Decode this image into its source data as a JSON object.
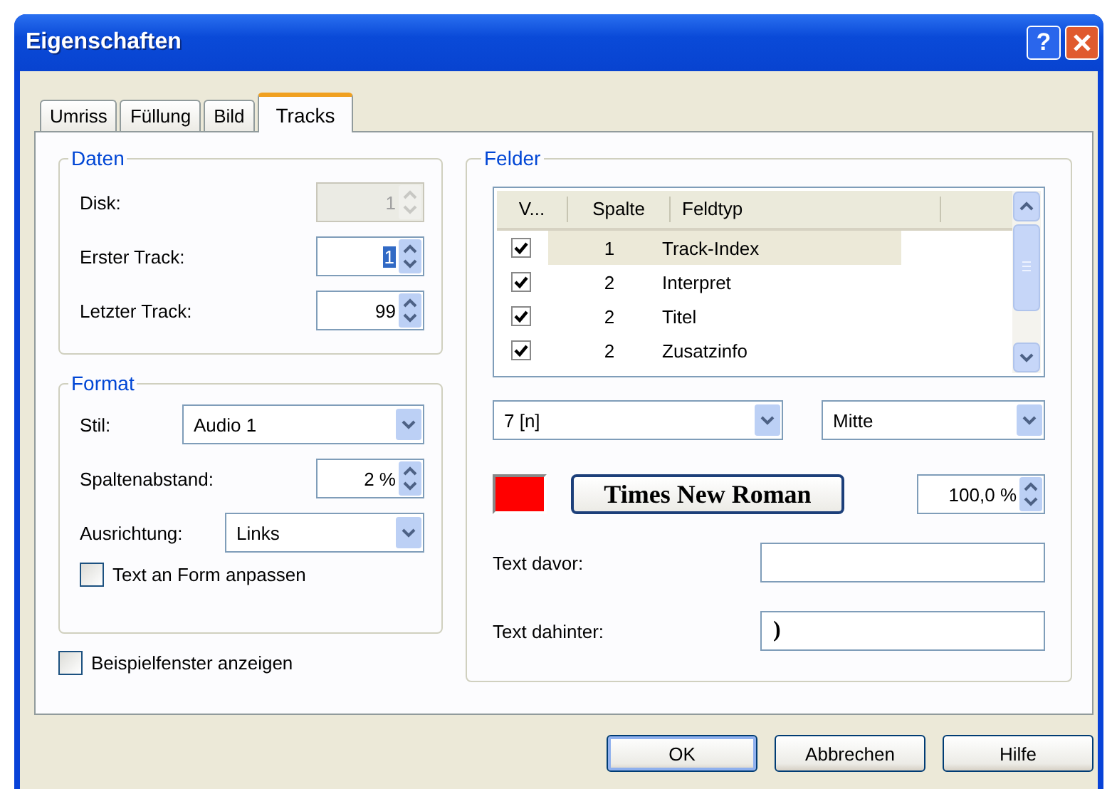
{
  "window": {
    "title": "Eigenschaften",
    "help": "?"
  },
  "tabs": [
    {
      "label": "Umriss",
      "selected": false
    },
    {
      "label": "Füllung",
      "selected": false
    },
    {
      "label": "Bild",
      "selected": false
    },
    {
      "label": "Tracks",
      "selected": true
    }
  ],
  "daten": {
    "title": "Daten",
    "rows": [
      {
        "label": "Disk:",
        "value": "1",
        "disabled": true,
        "selected": false
      },
      {
        "label": "Erster Track:",
        "value": "1",
        "disabled": false,
        "selected": true
      },
      {
        "label": "Letzter Track:",
        "value": "99",
        "disabled": false,
        "selected": false
      }
    ]
  },
  "format": {
    "title": "Format",
    "rows": [
      {
        "kind": "combo",
        "label": "Stil:",
        "value": "Audio 1"
      },
      {
        "kind": "spin",
        "label": "Spaltenabstand:",
        "value": "2 %"
      },
      {
        "kind": "combo",
        "label": "Ausrichtung:",
        "value": "Links"
      }
    ],
    "fit": {
      "label": "Text an Form anpassen",
      "checked": false
    }
  },
  "preview": {
    "label": "Beispielfenster anzeigen",
    "checked": false
  },
  "felder": {
    "title": "Felder",
    "columns": [
      "V...",
      "Spalte",
      "Feldtyp"
    ],
    "rows": [
      {
        "checked": true,
        "spalte": "1",
        "feldtyp": "Track-Index",
        "selected": true
      },
      {
        "checked": true,
        "spalte": "2",
        "feldtyp": "Interpret",
        "selected": false
      },
      {
        "checked": true,
        "spalte": "2",
        "feldtyp": "Titel",
        "selected": false
      },
      {
        "checked": true,
        "spalte": "2",
        "feldtyp": "Zusatzinfo",
        "selected": false
      }
    ],
    "number_format": "7 [n]",
    "position": "Mitte",
    "color": "#ff0000",
    "font": "Times New Roman",
    "size": "100,0 %",
    "text_fields": [
      {
        "label": "Text davor:"
      },
      {
        "label": "Text dahinter:",
        "value": ")"
      }
    ]
  },
  "buttons": [
    {
      "label": "OK",
      "default": true
    },
    {
      "label": "Abbrechen",
      "default": false
    },
    {
      "label": "Hilfe",
      "default": false
    }
  ]
}
